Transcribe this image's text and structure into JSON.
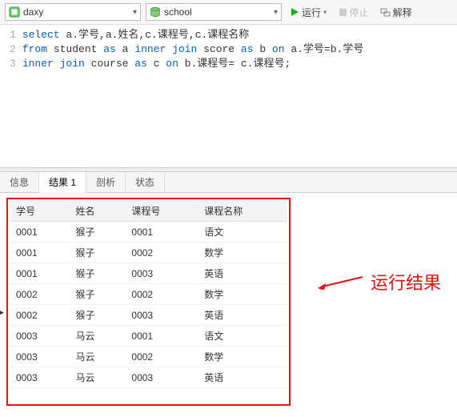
{
  "toolbar": {
    "connection": "daxy",
    "database": "school",
    "run_label": "运行",
    "stop_label": "停止",
    "explain_label": "解释"
  },
  "editor": {
    "lines": [
      {
        "n": "1",
        "tokens": [
          {
            "t": "select ",
            "c": "kw"
          },
          {
            "t": "a.学号,a.姓名,c.课程号,c.课程名称",
            "c": "ident"
          }
        ]
      },
      {
        "n": "2",
        "tokens": [
          {
            "t": "from ",
            "c": "kw"
          },
          {
            "t": "student ",
            "c": "ident"
          },
          {
            "t": "as ",
            "c": "kw"
          },
          {
            "t": "a ",
            "c": "ident"
          },
          {
            "t": "inner join ",
            "c": "kw"
          },
          {
            "t": "score ",
            "c": "ident"
          },
          {
            "t": "as ",
            "c": "kw"
          },
          {
            "t": "b ",
            "c": "ident"
          },
          {
            "t": "on ",
            "c": "kw"
          },
          {
            "t": "a.学号=b.学号",
            "c": "ident"
          }
        ]
      },
      {
        "n": "3",
        "tokens": [
          {
            "t": "inner join ",
            "c": "kw"
          },
          {
            "t": "course ",
            "c": "ident"
          },
          {
            "t": "as ",
            "c": "kw"
          },
          {
            "t": "c ",
            "c": "ident"
          },
          {
            "t": "on ",
            "c": "kw"
          },
          {
            "t": "b.课程号= c.课程号;",
            "c": "ident"
          }
        ]
      }
    ]
  },
  "tabs": {
    "items": [
      {
        "label": "信息",
        "active": false
      },
      {
        "label": "结果 1",
        "active": true
      },
      {
        "label": "剖析",
        "active": false
      },
      {
        "label": "状态",
        "active": false
      }
    ]
  },
  "results": {
    "columns": [
      "学号",
      "姓名",
      "课程号",
      "课程名称"
    ],
    "rows": [
      [
        "0001",
        "猴子",
        "0001",
        "语文"
      ],
      [
        "0001",
        "猴子",
        "0002",
        "数学"
      ],
      [
        "0001",
        "猴子",
        "0003",
        "英语"
      ],
      [
        "0002",
        "猴子",
        "0002",
        "数学"
      ],
      [
        "0002",
        "猴子",
        "0003",
        "英语"
      ],
      [
        "0003",
        "马云",
        "0001",
        "语文"
      ],
      [
        "0003",
        "马云",
        "0002",
        "数学"
      ],
      [
        "0003",
        "马云",
        "0003",
        "英语"
      ]
    ],
    "marker_row_index": 4
  },
  "annotation": {
    "text": "运行结果"
  }
}
